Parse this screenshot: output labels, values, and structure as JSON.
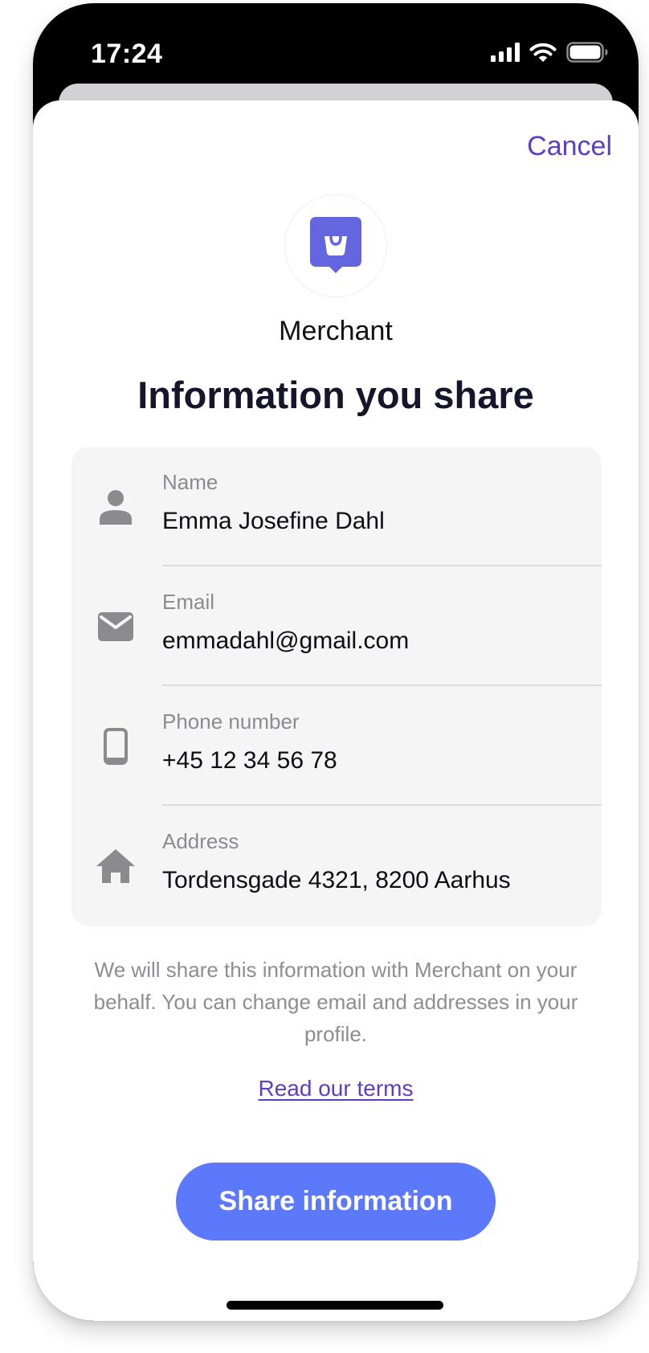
{
  "status_bar": {
    "time": "17:24",
    "icons": [
      "cellular-signal-icon",
      "wifi-icon",
      "battery-icon"
    ]
  },
  "header": {
    "cancel_label": "Cancel"
  },
  "merchant": {
    "name": "Merchant",
    "logo_icon": "shopping-bag-icon"
  },
  "title": "Information you share",
  "info": {
    "items": [
      {
        "label": "Name",
        "value": "Emma Josefine Dahl",
        "icon": "person-icon"
      },
      {
        "label": "Email",
        "value": "emmadahl@gmail.com",
        "icon": "envelope-icon"
      },
      {
        "label": "Phone number",
        "value": "+45 12 34 56 78",
        "icon": "phone-icon"
      },
      {
        "label": "Address",
        "value": "Tordensgade 4321, 8200 Aarhus",
        "icon": "home-icon"
      }
    ]
  },
  "disclaimer": "We will share this information with Merchant on your behalf. You can change email and addresses in your profile.",
  "terms_link": "Read our terms",
  "share_button": "Share information",
  "colors": {
    "accent": "#5b40c6",
    "button": "#5c78fb",
    "brand_logo": "#6466e0",
    "card_background": "#f5f5f6",
    "icon_gray": "#8a8a8f"
  }
}
